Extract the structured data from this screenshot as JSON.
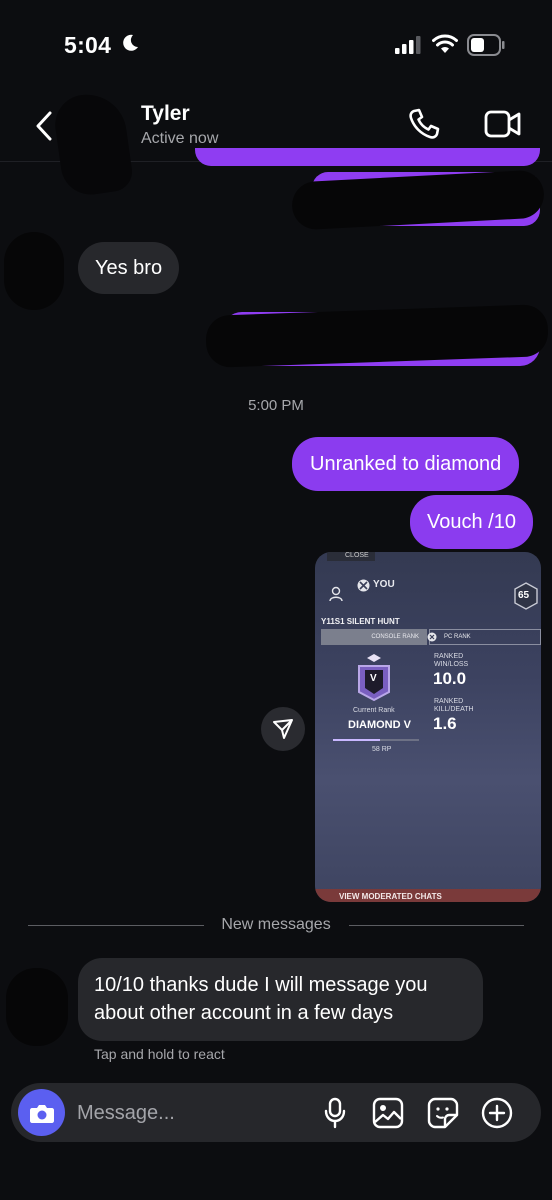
{
  "status_bar": {
    "time": "5:04"
  },
  "header": {
    "name": "Tyler",
    "status": "Active now"
  },
  "messages": {
    "incoming_1": "Yes bro",
    "timestamp": "5:00 PM",
    "outgoing_1": "Unranked to diamond",
    "outgoing_2": "Vouch /10",
    "incoming_2": "10/10 thanks dude I will message you about other account in a few days"
  },
  "shared_image": {
    "close_label": "CLOSE",
    "you_label": "YOU",
    "game_title": "Y11S1 SILENT HUNT",
    "tab_console": "CONSOLE RANK",
    "tab_pc": "PC RANK",
    "rank_letter": "V",
    "current_rank_label": "Current Rank",
    "rank_name": "DIAMOND V",
    "rp": "58 RP",
    "rank_progress": 0.55,
    "wl_label_1": "RANKED",
    "wl_label_2": "WIN/LOSS",
    "wl_value": "10.0",
    "kd_label_1": "RANKED",
    "kd_label_2": "KILL/DEATH",
    "kd_value": "1.6",
    "level": "65",
    "footer": "VIEW MODERATED CHATS"
  },
  "divider": {
    "text": "New messages"
  },
  "react_hint": "Tap and hold to react",
  "composer": {
    "placeholder": "Message..."
  },
  "colors": {
    "outgoing_bubble": "#8b3cef",
    "incoming_bubble": "#27282c",
    "camera_button": "#5b5ff0",
    "background": "#0c0d10"
  },
  "icons": [
    "moon-icon",
    "signal-icon",
    "wifi-icon",
    "battery-icon",
    "back-chevron-icon",
    "phone-icon",
    "video-camera-icon",
    "share-arrow-icon",
    "camera-icon",
    "microphone-icon",
    "gallery-icon",
    "sticker-icon",
    "plus-circle-icon"
  ]
}
